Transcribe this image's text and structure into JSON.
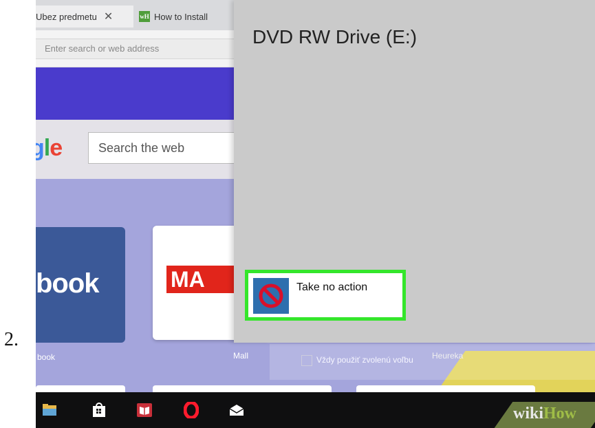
{
  "step": {
    "number": "2."
  },
  "browser": {
    "tabs": [
      {
        "title": "Ubez predmetu",
        "close": "✕"
      },
      {
        "favicon": "wH",
        "title": "How to Install"
      }
    ],
    "address_placeholder": "Enter search or web address",
    "search_placeholder": "Search the web",
    "google_logo_partial": [
      "g",
      "l",
      "e"
    ],
    "tiles": [
      {
        "name": "facebook",
        "tile_text": "book",
        "label": "book"
      },
      {
        "name": "mall",
        "tile_text": "MA",
        "label": "Mall"
      },
      {
        "name": "heureka",
        "label": "Heureka"
      }
    ]
  },
  "autoplay": {
    "title": "DVD RW Drive (E:)",
    "option": {
      "label": "Take no action",
      "icon": "no-action-icon"
    },
    "always_checkbox_label": "Vždy použiť zvolenú voľbu"
  },
  "taskbar": {
    "icons": [
      "file-explorer-icon",
      "store-icon",
      "books-icon",
      "opera-icon",
      "mail-icon"
    ]
  },
  "watermark": {
    "wiki": "wiki",
    "how": "How"
  },
  "colors": {
    "highlight": "#34e62b",
    "flyout_bg": "#cacaca",
    "option_icon_bg": "#2e6fae",
    "facebook": "#3b5998",
    "mall": "#e1251b",
    "banner": "#4a3bcc"
  }
}
